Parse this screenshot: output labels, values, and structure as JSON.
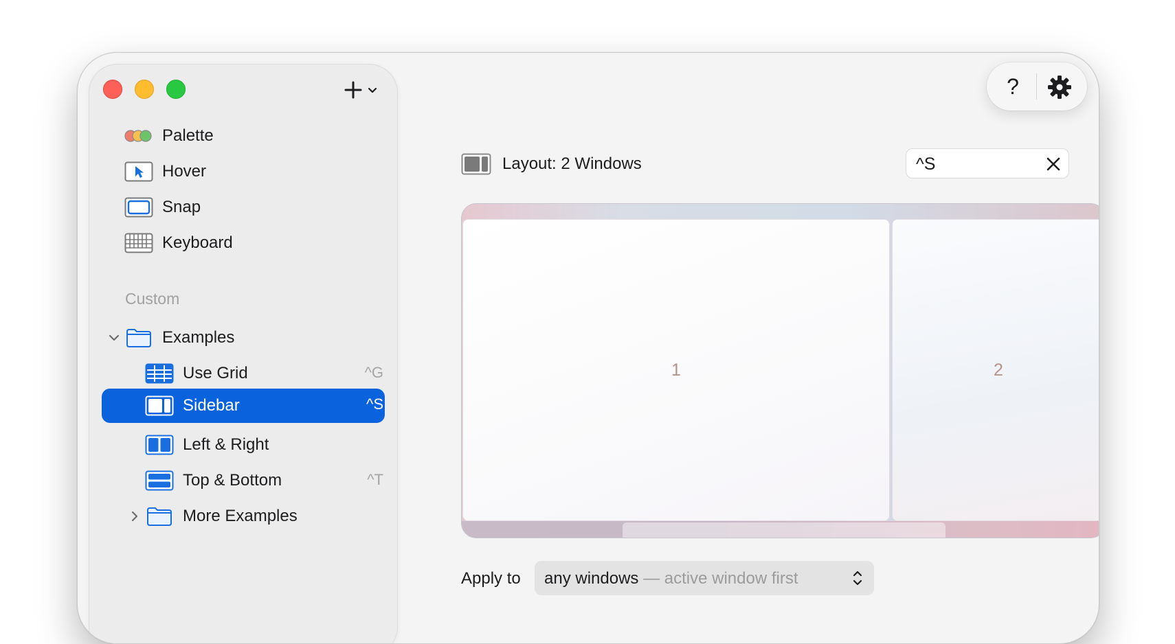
{
  "window": {
    "add_label": "+"
  },
  "sidebar": {
    "items": [
      {
        "label": "Palette",
        "icon": "palette-icon"
      },
      {
        "label": "Hover",
        "icon": "cursor-icon"
      },
      {
        "label": "Snap",
        "icon": "snap-window-icon"
      },
      {
        "label": "Keyboard",
        "icon": "keyboard-icon"
      }
    ],
    "section_label": "Custom",
    "folder": {
      "label": "Examples",
      "expanded": true
    },
    "layouts": [
      {
        "label": "Use Grid",
        "shortcut": "^G",
        "icon": "grid-icon"
      },
      {
        "label": "Sidebar",
        "shortcut": "^S",
        "icon": "sidebar-layout-icon",
        "selected": true
      },
      {
        "label": "Left & Right",
        "shortcut": "",
        "icon": "left-right-layout-icon"
      },
      {
        "label": "Top & Bottom",
        "shortcut": "^T",
        "icon": "top-bottom-layout-icon"
      }
    ],
    "subfolder": {
      "label": "More Examples",
      "expanded": false
    }
  },
  "main": {
    "title": "Layout: 2 Windows",
    "shortcut_value": "^S",
    "help_label": "?",
    "preview": {
      "pane_1": "1",
      "pane_2": "2"
    },
    "apply_label": "Apply to",
    "apply_value": "any windows",
    "apply_dash": " — ",
    "apply_suffix": "active window first"
  },
  "colors": {
    "accent": "#0a63dc",
    "icon_blue": "#1a6fe0",
    "close": "#fe5f57",
    "minimize": "#febc2e",
    "maximize": "#28c840"
  }
}
